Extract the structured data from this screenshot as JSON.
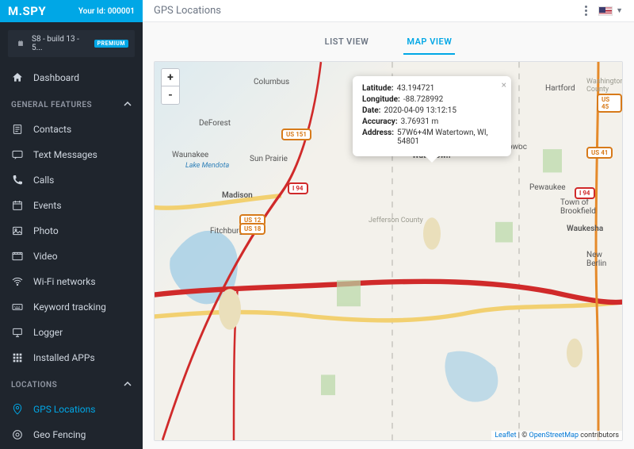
{
  "brand": "M.SPY",
  "your_id_label": "Your Id:",
  "your_id_value": "000001",
  "device": {
    "name": "S8 - build 13 - 5...",
    "badge": "PREMIUM"
  },
  "sidebar": {
    "dashboard": "Dashboard",
    "sections": {
      "general": {
        "title": "GENERAL FEATURES",
        "items": [
          "Contacts",
          "Text Messages",
          "Calls",
          "Events",
          "Photo",
          "Video",
          "Wi-Fi networks",
          "Keyword tracking",
          "Logger",
          "Installed APPs"
        ]
      },
      "locations": {
        "title": "LOCATIONS",
        "items": [
          "GPS Locations",
          "Geo Fencing"
        ]
      }
    }
  },
  "page_title": "GPS Locations",
  "tabs": {
    "list": "LIST VIEW",
    "map": "MAP VIEW"
  },
  "popup": {
    "latitude_label": "Latitude:",
    "latitude_value": "43.194721",
    "longitude_label": "Longitude:",
    "longitude_value": "-88.728992",
    "date_label": "Date:",
    "date_value": "2020-04-09 13:12:15",
    "accuracy_label": "Accuracy:",
    "accuracy_value": "3.76931 m",
    "address_label": "Address:",
    "address_value": "57W6+4M Watertown, WI, 54801"
  },
  "map_labels": {
    "madison": "Madison",
    "sun_prairie": "Sun Prairie",
    "waunakee": "Waunakee",
    "fitchburg": "Fitchburg",
    "deforest": "DeForest",
    "columbus": "Columbus",
    "watertown": "Watertown",
    "oconomowoc": "Oconomowoc",
    "hartford": "Hartford",
    "pewaukee": "Pewaukee",
    "brookfield": "Town of Brookfield",
    "waukesha": "Waukesha",
    "lake_mendota": "Lake Mendota",
    "jefferson": "Jefferson County",
    "washington": "Washington County",
    "new_berlin": "New Berlin"
  },
  "highways": {
    "i94": "I 94",
    "us12": "US 12",
    "us18": "US 18",
    "us151": "US 151",
    "us41": "US 41",
    "us45": "US 45"
  },
  "attribution": {
    "leaflet": "Leaflet",
    "sep": " | © ",
    "osm": "OpenStreetMap",
    "tail": " contributors"
  },
  "zoom": {
    "in": "+",
    "out": "-"
  }
}
